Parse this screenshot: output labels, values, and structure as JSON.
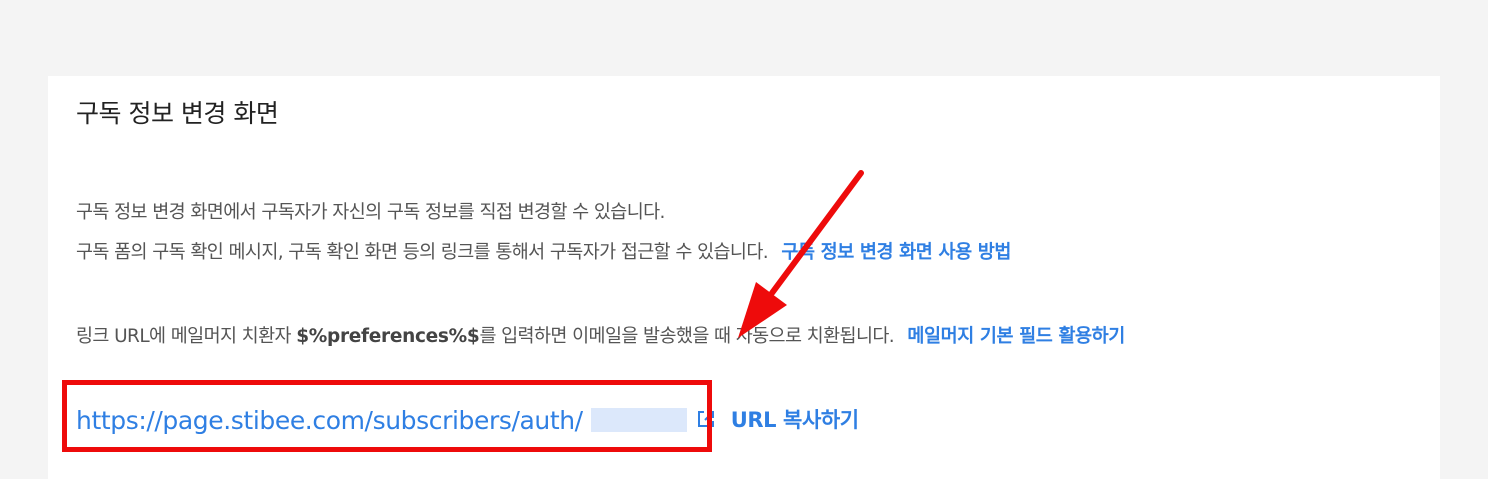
{
  "section": {
    "title": "구독 정보 변경 화면",
    "description_line1": "구독 정보 변경 화면에서 구독자가 자신의 구독 정보를 직접 변경할 수 있습니다.",
    "description_line2": "구독 폼의 구독 확인 메시지, 구독 확인 화면 등의 링크를 통해서 구독자가 접근할 수 있습니다.",
    "usage_link_label": "구독 정보 변경 화면 사용 방법",
    "substitution_prefix": "링크 URL에 메일머지 치환자",
    "substitution_token": "$%preferences%$",
    "substitution_suffix": "를 입력하면 이메일을 발송했을 때 자동으로 치환됩니다.",
    "merge_field_link_label": "메일머지 기본 필드 활용하기",
    "url_text": "https://page.stibee.com/subscribers/auth/",
    "copy_url_label": "URL 복사하기"
  },
  "icons": {
    "external_link": "external-link-icon",
    "annotation_arrow": "arrow-annotation"
  },
  "colors": {
    "link": "#2f7fe3",
    "annotation": "#ee0b0b",
    "page_background": "#f4f4f4",
    "panel_background": "#ffffff"
  }
}
